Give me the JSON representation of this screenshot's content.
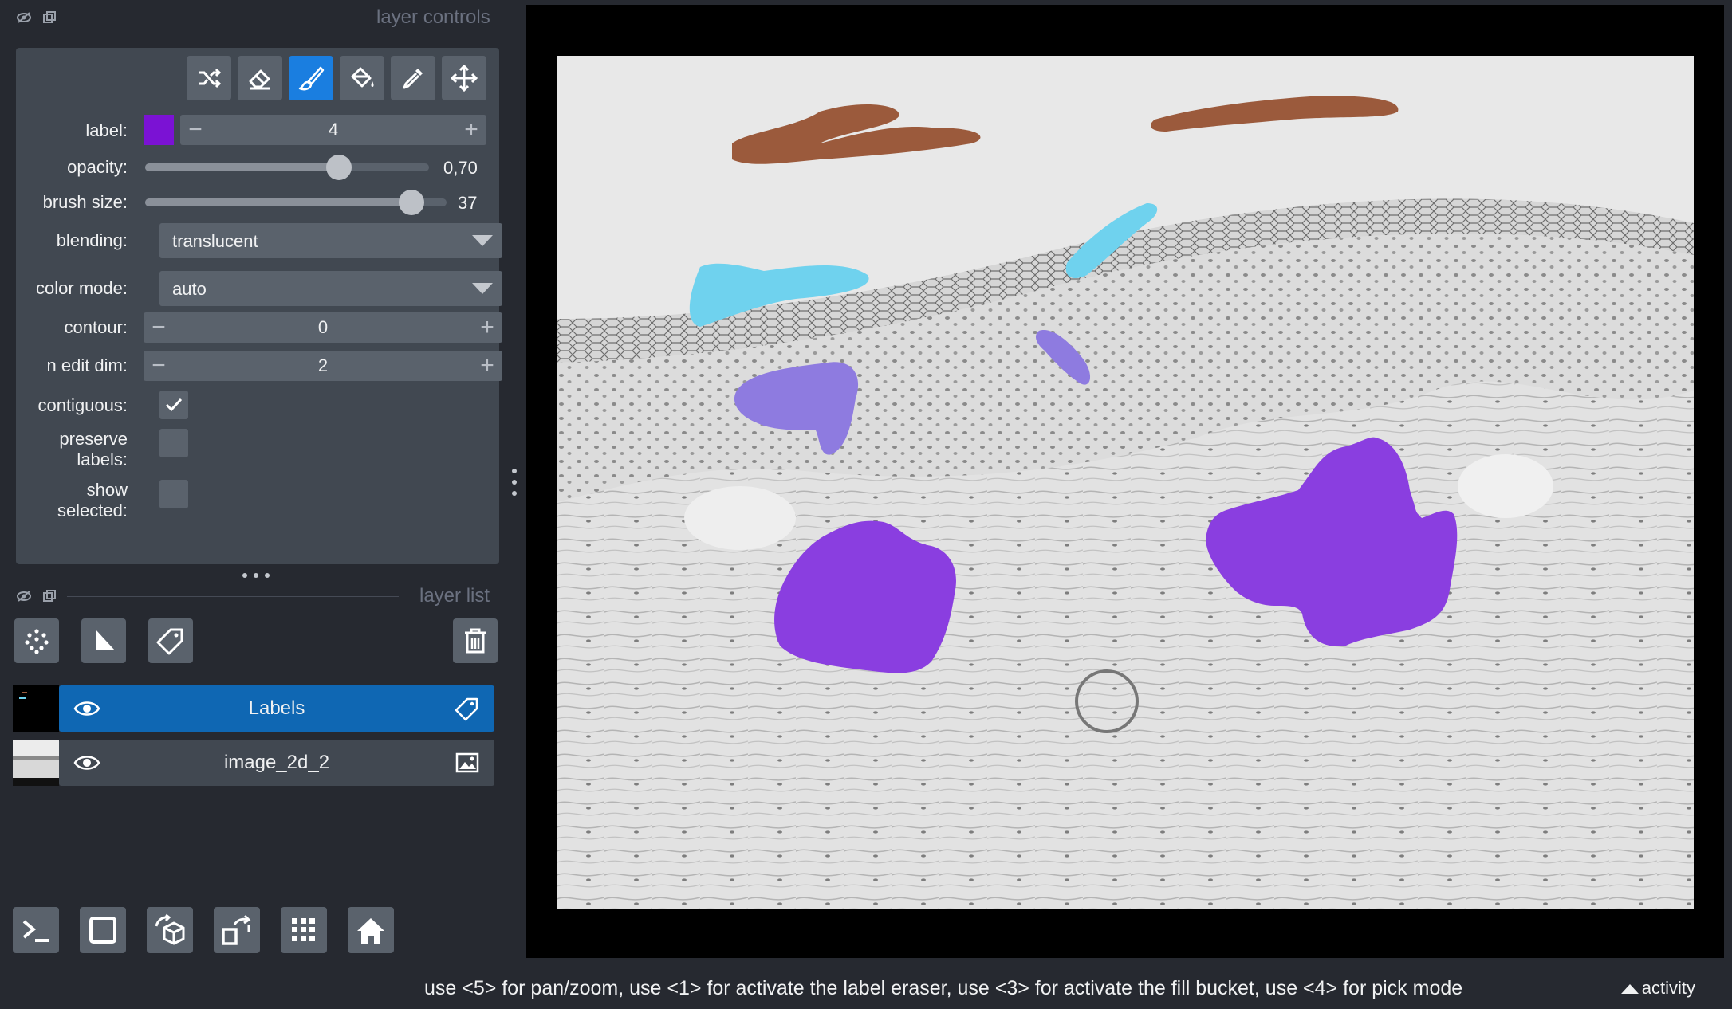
{
  "layer_controls": {
    "title": "layer controls",
    "label": {
      "label": "label:",
      "value": "4",
      "color": "#7b12d4"
    },
    "opacity": {
      "label": "opacity:",
      "value": "0,70",
      "fraction": 0.7
    },
    "brush_size": {
      "label": "brush size:",
      "value": "37",
      "fraction": 0.9
    },
    "blending": {
      "label": "blending:",
      "value": "translucent"
    },
    "color_mode": {
      "label": "color mode:",
      "value": "auto"
    },
    "contour": {
      "label": "contour:",
      "value": "0"
    },
    "n_edit_dim": {
      "label": "n edit dim:",
      "value": "2"
    },
    "contiguous": {
      "label": "contiguous:",
      "checked": true
    },
    "preserve_labels": {
      "label_line1": "preserve",
      "label_line2": "labels:",
      "checked": false
    },
    "show_selected": {
      "label_line1": "show",
      "label_line2": "selected:",
      "checked": false
    },
    "tools": [
      "shuffle-icon",
      "eraser-icon",
      "paintbrush-icon",
      "fill-bucket-icon",
      "color-picker-icon",
      "pan-zoom-icon"
    ],
    "active_tool": "paintbrush-icon"
  },
  "layer_list": {
    "title": "layer list",
    "layers": [
      {
        "name": "Labels",
        "type_icon": "label-tag-icon",
        "selected": true
      },
      {
        "name": "image_2d_2",
        "type_icon": "image-icon",
        "selected": false
      }
    ]
  },
  "status": {
    "message": "use <5> for pan/zoom, use <1> for activate the label eraser, use <3> for activate the fill bucket, use <4> for pick mode",
    "activity": "activity"
  },
  "colors": {
    "accent": "#1a7ee0",
    "panel_bg": "#262930",
    "control_bg": "#414851",
    "label_brown": "#9b5a3c",
    "label_cyan": "#6fd2ee",
    "label_lavender": "#8e7be0",
    "label_purple": "#8a3ee0"
  }
}
